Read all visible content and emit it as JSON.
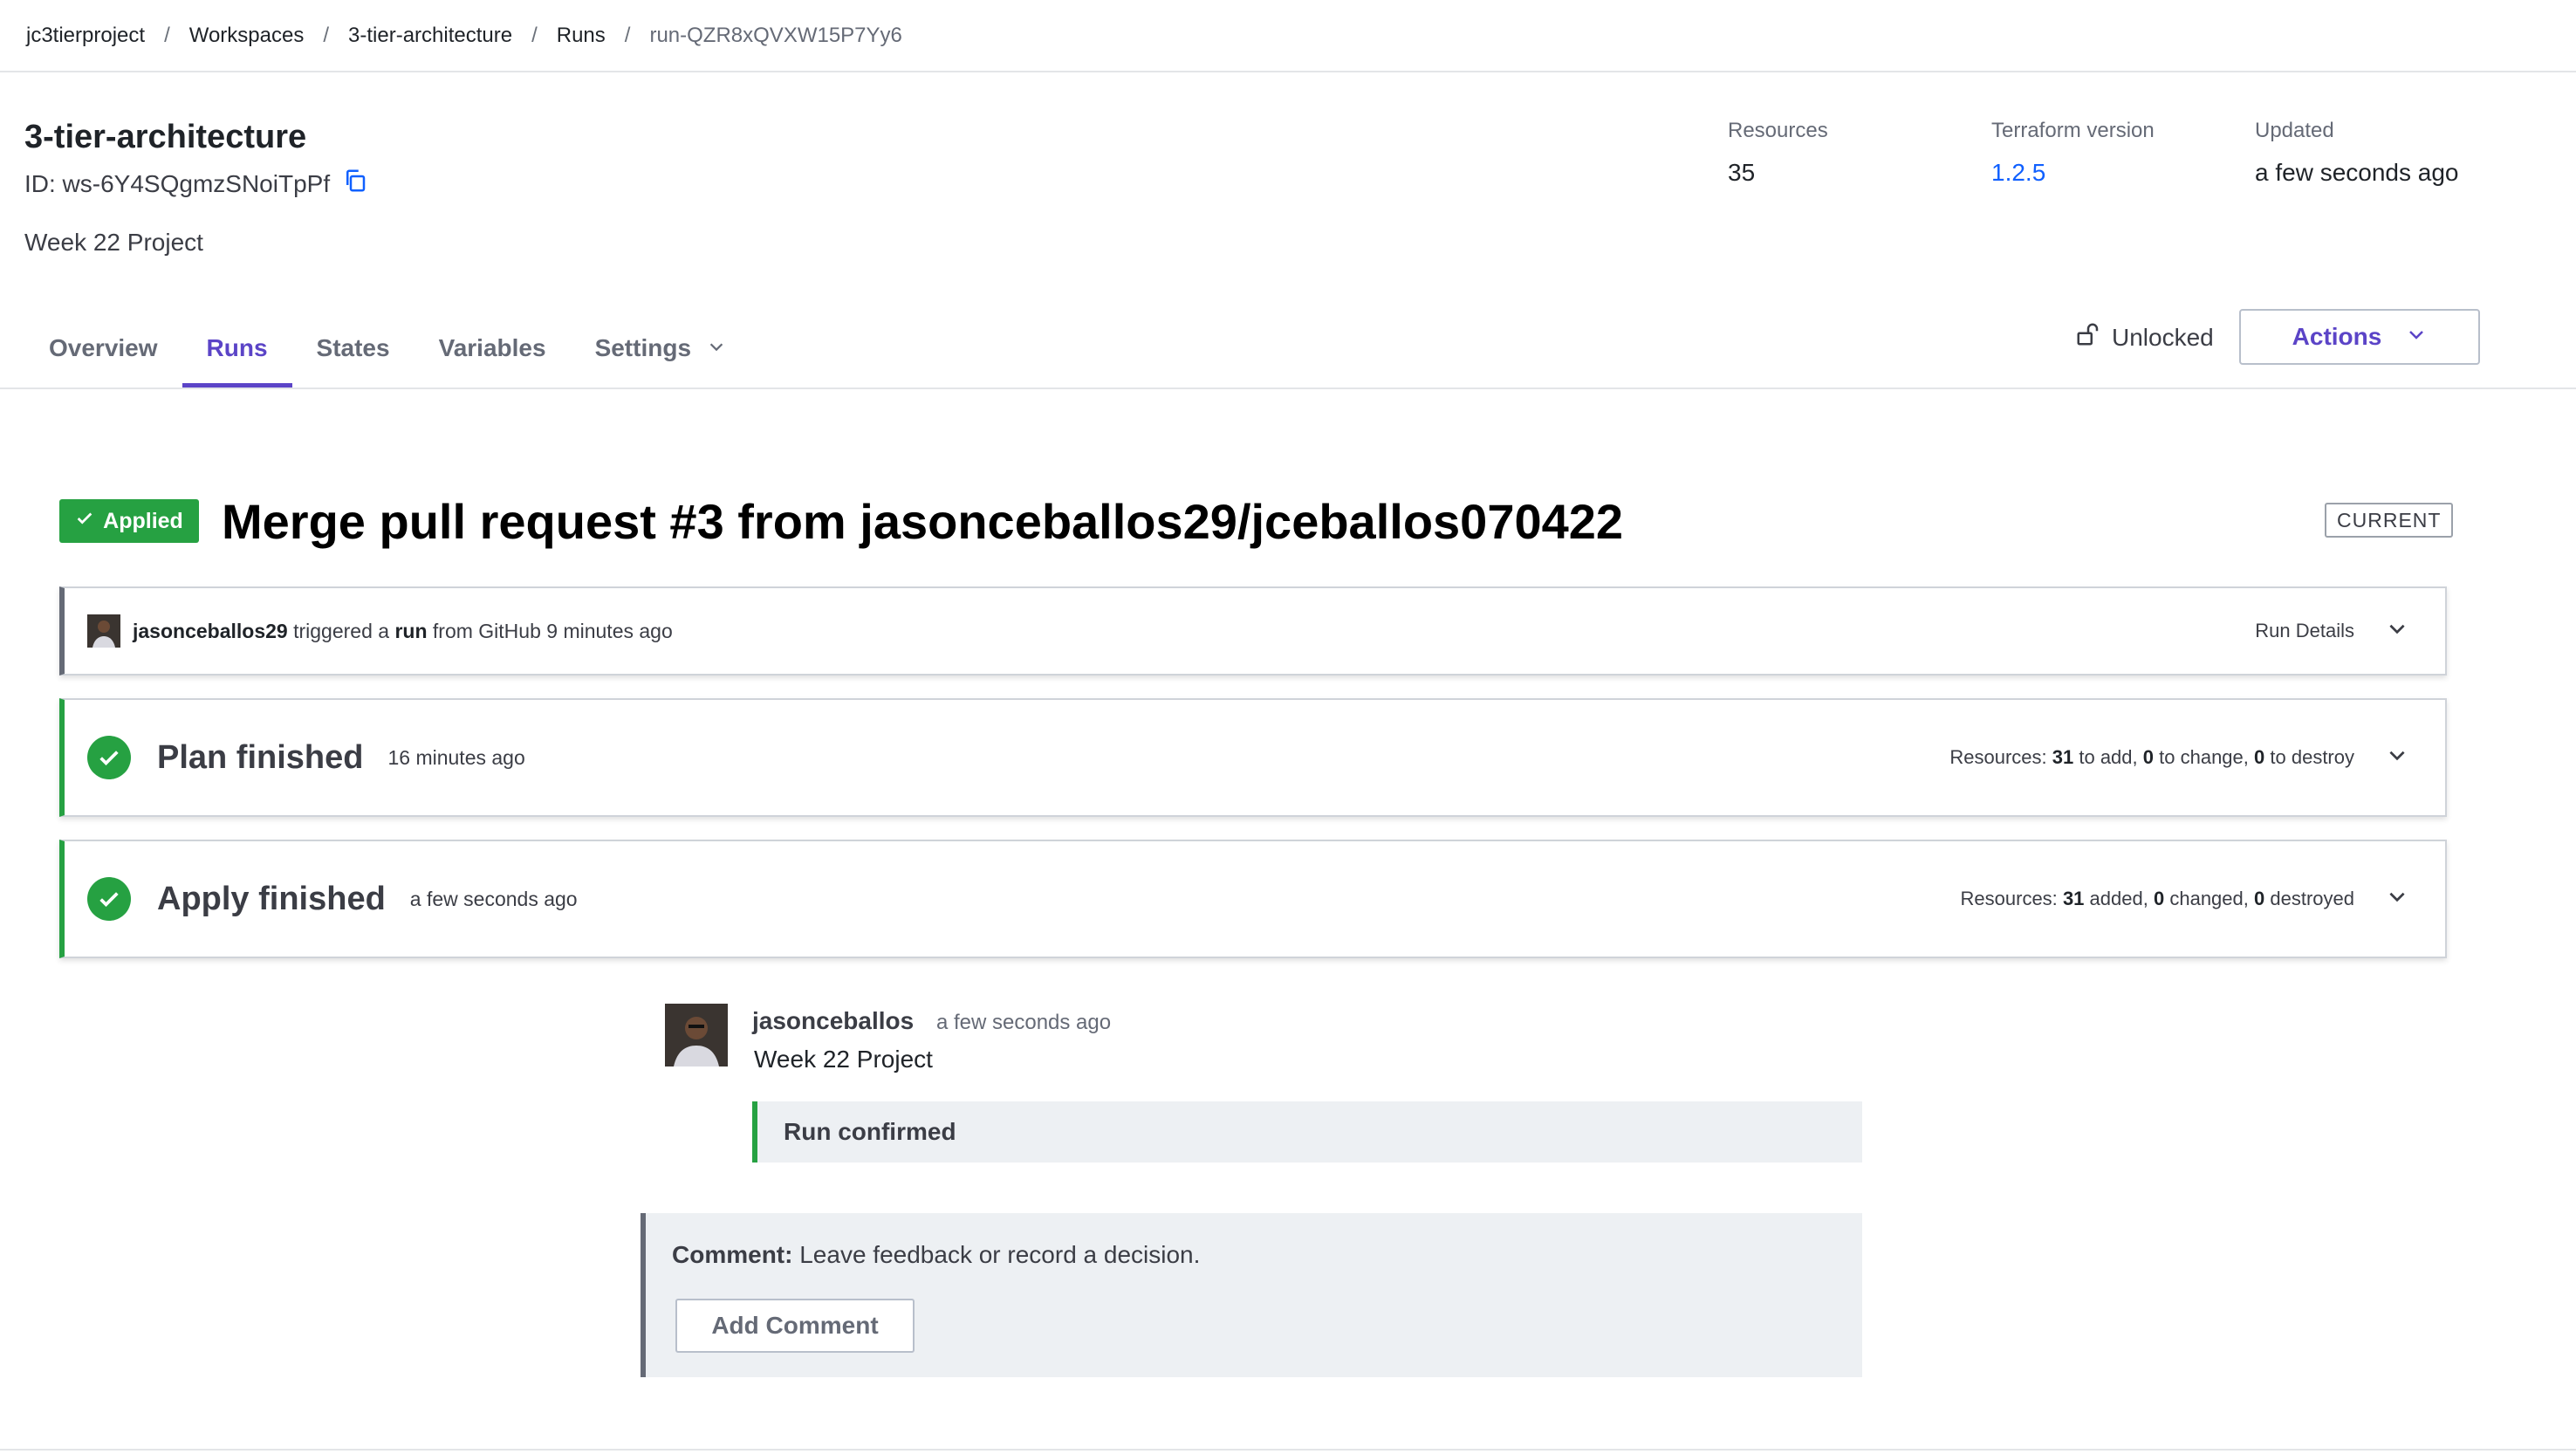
{
  "breadcrumb": {
    "org": "jc3tierproject",
    "workspaces": "Workspaces",
    "workspace": "3-tier-architecture",
    "runs": "Runs",
    "run_id": "run-QZR8xQVXW15P7Yy6",
    "separator": "/"
  },
  "workspace": {
    "name": "3-tier-architecture",
    "id": "ID: ws-6Y4SQgmzSNoiTpPf",
    "description": "Week 22 Project"
  },
  "meta": {
    "resources_label": "Resources",
    "resources_value": "35",
    "tf_label": "Terraform version",
    "tf_value": "1.2.5",
    "updated_label": "Updated",
    "updated_value": "a few seconds ago"
  },
  "tabs": [
    {
      "label": "Overview"
    },
    {
      "label": "Runs"
    },
    {
      "label": "States"
    },
    {
      "label": "Variables"
    },
    {
      "label": "Settings"
    }
  ],
  "lock_status": "Unlocked",
  "actions_label": "Actions",
  "run": {
    "status": "Applied",
    "title": "Merge pull request #3 from jasonceballos29/jceballos070422",
    "current_badge": "CURRENT"
  },
  "trigger": {
    "user": "jasonceballos29",
    "text1": "triggered a",
    "run_word": "run",
    "text2": "from GitHub 9 minutes ago",
    "details_label": "Run Details"
  },
  "plan": {
    "title": "Plan finished",
    "time": "16 minutes ago",
    "res_prefix": "Resources:",
    "add_count": "31",
    "add_text": "to add,",
    "change_count": "0",
    "change_text": "to change,",
    "destroy_count": "0",
    "destroy_text": "to destroy"
  },
  "apply": {
    "title": "Apply finished",
    "time": "a few seconds ago",
    "res_prefix": "Resources:",
    "added_count": "31",
    "added_text": "added,",
    "changed_count": "0",
    "changed_text": "changed,",
    "destroyed_count": "0",
    "destroyed_text": "destroyed"
  },
  "comment": {
    "author": "jasonceballos",
    "time": "a few seconds ago",
    "text": "Week 22 Project",
    "confirmed": "Run confirmed"
  },
  "new_comment": {
    "label": "Comment:",
    "placeholder": "Leave feedback or record a decision.",
    "button": "Add Comment"
  },
  "colors": {
    "accent": "#5b44c7",
    "success": "#26a142",
    "link": "#1060ff"
  }
}
